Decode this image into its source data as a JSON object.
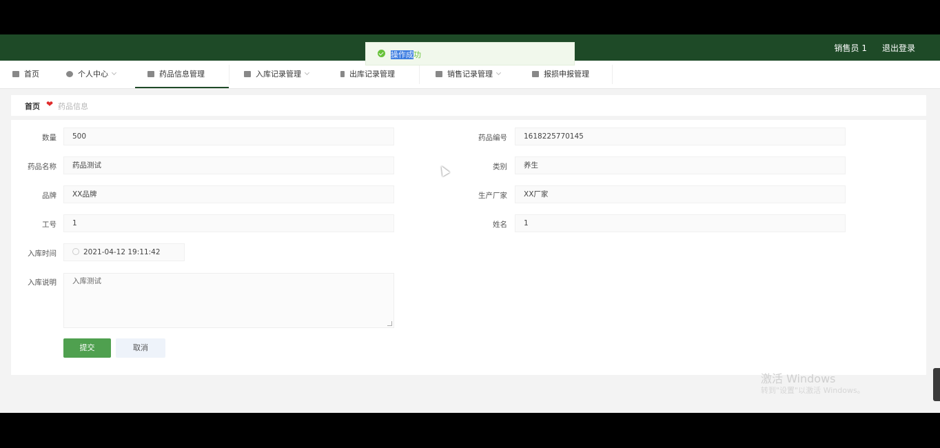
{
  "header": {
    "user": "销售员 1",
    "logout": "退出登录"
  },
  "toast": {
    "highlighted": "操作成",
    "rest": "功"
  },
  "nav": {
    "items": [
      {
        "label": "首页"
      },
      {
        "label": "个人中心"
      },
      {
        "label": "药品信息管理"
      },
      {
        "label": "入库记录管理"
      },
      {
        "label": "出库记录管理"
      },
      {
        "label": "销售记录管理"
      },
      {
        "label": "报损申报管理"
      }
    ]
  },
  "breadcrumb": {
    "home": "首页",
    "current": "药品信息"
  },
  "form": {
    "left": [
      {
        "label": "数量",
        "value": "500"
      },
      {
        "label": "药品名称",
        "value": "药品测试"
      },
      {
        "label": "品牌",
        "value": "XX品牌"
      },
      {
        "label": "工号",
        "value": "1"
      },
      {
        "label": "入库时间",
        "value": "2021-04-12 19:11:42"
      },
      {
        "label": "入库说明",
        "value": "入库测试"
      }
    ],
    "right": [
      {
        "label": "药品编号",
        "value": "1618225770145"
      },
      {
        "label": "类别",
        "value": "养生"
      },
      {
        "label": "生产厂家",
        "value": "XX厂家"
      },
      {
        "label": "姓名",
        "value": "1"
      }
    ],
    "submit": "提交",
    "cancel": "取消"
  },
  "watermark": {
    "line1": "激活 Windows",
    "line2": "转到\"设置\"以激活 Windows。"
  },
  "colors": {
    "header_bg": "#1e4a27",
    "submit_bg": "#4fa04f",
    "toast_icon": "#67c23a"
  }
}
